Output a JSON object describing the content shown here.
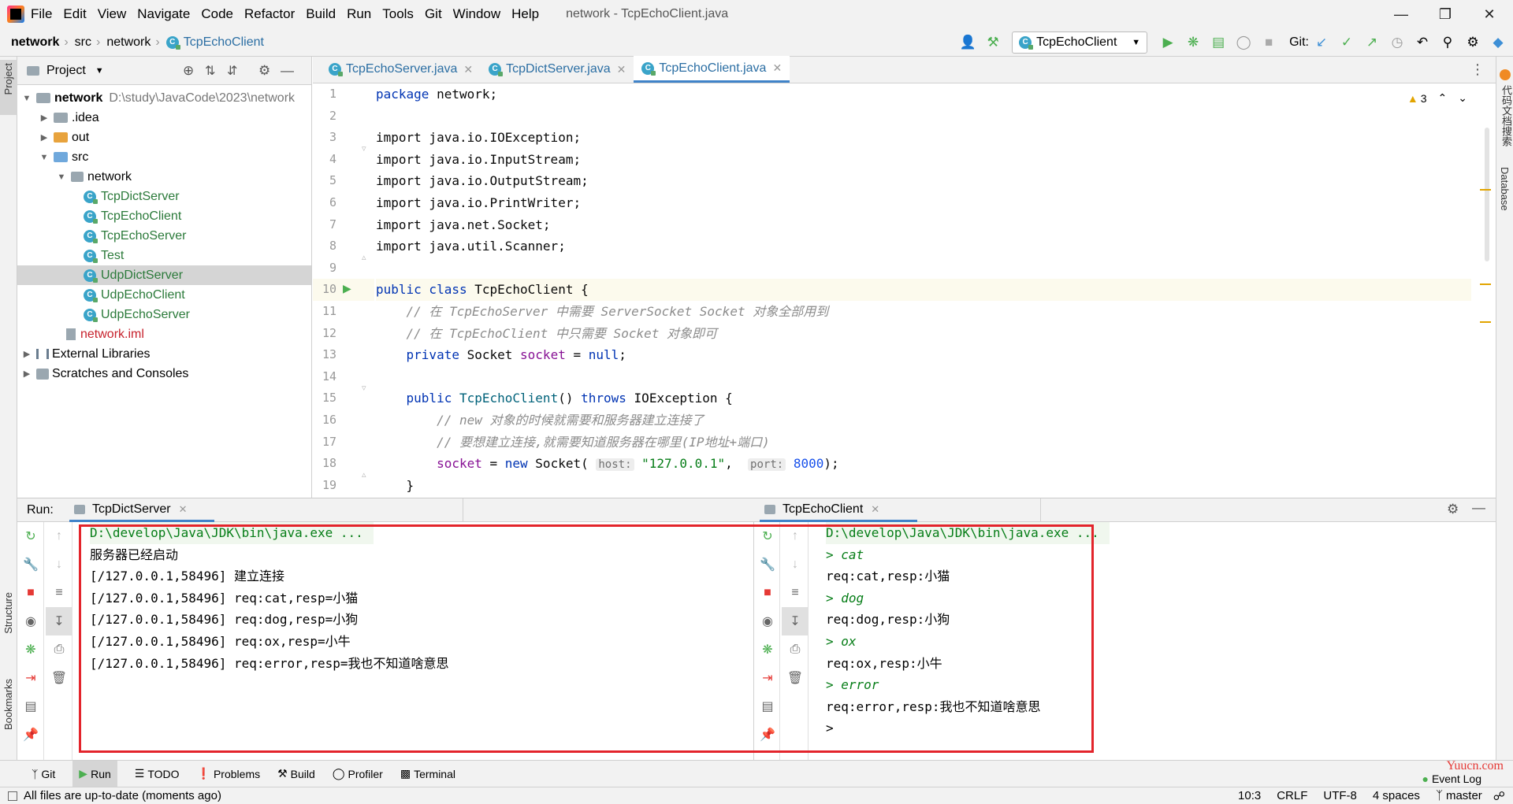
{
  "menubar": {
    "items": [
      "File",
      "Edit",
      "View",
      "Navigate",
      "Code",
      "Refactor",
      "Build",
      "Run",
      "Tools",
      "Git",
      "Window",
      "Help"
    ],
    "title": "network - TcpEchoClient.java"
  },
  "navbar": {
    "breadcrumbs": [
      "network",
      "src",
      "network",
      "TcpEchoClient"
    ],
    "run_config": "TcpEchoClient",
    "git_label": "Git:"
  },
  "project": {
    "title": "Project",
    "root_name": "network",
    "root_path": "D:\\study\\JavaCode\\2023\\network",
    "items": [
      {
        "label": "network",
        "level": 0
      },
      {
        "label": ".idea",
        "level": 1
      },
      {
        "label": "out",
        "level": 1
      },
      {
        "label": "src",
        "level": 1
      },
      {
        "label": "network",
        "level": 2
      },
      {
        "label": "TcpDictServer",
        "level": 3
      },
      {
        "label": "TcpEchoClient",
        "level": 3
      },
      {
        "label": "TcpEchoServer",
        "level": 3
      },
      {
        "label": "Test",
        "level": 3
      },
      {
        "label": "UdpDictServer",
        "level": 3
      },
      {
        "label": "UdpEchoClient",
        "level": 3
      },
      {
        "label": "UdpEchoServer",
        "level": 3
      },
      {
        "label": "network.iml",
        "level": 2
      },
      {
        "label": "External Libraries",
        "level": 0
      },
      {
        "label": "Scratches and Consoles",
        "level": 0
      }
    ]
  },
  "editor": {
    "tabs": [
      "TcpEchoServer.java",
      "TcpDictServer.java",
      "TcpEchoClient.java"
    ],
    "active_tab": 2,
    "warnings": "3",
    "line_numbers": [
      "1",
      "2",
      "3",
      "4",
      "5",
      "6",
      "7",
      "8",
      "9",
      "10",
      "11",
      "12",
      "13",
      "14",
      "15",
      "16",
      "17",
      "18",
      "19"
    ],
    "code": {
      "l1": "package network;",
      "l3": "import java.io.IOException;",
      "l4": "import java.io.InputStream;",
      "l5": "import java.io.OutputStream;",
      "l6": "import java.io.PrintWriter;",
      "l7": "import java.net.Socket;",
      "l8": "import java.util.Scanner;",
      "l10_kw": "public class ",
      "l10_name": "TcpEchoClient {",
      "l11": "// 在 TcpEchoServer 中需要 ServerSocket Socket 对象全部用到",
      "l12": "// 在 TcpEchoClient 中只需要 Socket 对象即可",
      "l13_kw": "private ",
      "l13_type": "Socket ",
      "l13_field": "socket",
      "l13_rest": " = ",
      "l13_null": "null",
      "l13_end": ";",
      "l15_kw": "public ",
      "l15_name": "TcpEchoClient",
      "l15_paren": "() ",
      "l15_throws": "throws ",
      "l15_rest": "IOException {",
      "l16": "// new 对象的时候就需要和服务器建立连接了",
      "l17": "// 要想建立连接,就需要知道服务器在哪里(IP地址+端口)",
      "l18_field": "socket",
      "l18_eq": " = ",
      "l18_new": "new ",
      "l18_cls": "Socket( ",
      "l18_hint1": "host:",
      "l18_str": "\"127.0.0.1\"",
      "l18_comma": ",  ",
      "l18_hint2": "port:",
      "l18_num": "8000",
      "l18_end": ");",
      "l19": "}"
    }
  },
  "run": {
    "label": "Run:",
    "tab_left": "TcpDictServer",
    "tab_right": "TcpEchoClient",
    "left_console": [
      "D:\\develop\\Java\\JDK\\bin\\java.exe ...",
      "服务器已经启动",
      "[/127.0.0.1,58496] 建立连接",
      "[/127.0.0.1,58496] req:cat,resp=小猫",
      "[/127.0.0.1,58496] req:dog,resp=小狗",
      "[/127.0.0.1,58496] req:ox,resp=小牛",
      "[/127.0.0.1,58496] req:error,resp=我也不知道啥意思"
    ],
    "right_console": [
      "D:\\develop\\Java\\JDK\\bin\\java.exe ...",
      "> cat",
      "req:cat,resp:小猫",
      "> dog",
      "req:dog,resp:小狗",
      "> ox",
      "req:ox,resp:小牛",
      "> error",
      "req:error,resp:我也不知道啥意思",
      ">"
    ]
  },
  "side": {
    "left_project": "Project",
    "left_structure": "Structure",
    "left_bookmarks": "Bookmarks",
    "right_top": "代码文档搜索",
    "right_db": "Database"
  },
  "bottom_tabs": [
    "Git",
    "Run",
    "TODO",
    "Problems",
    "Build",
    "Profiler",
    "Terminal"
  ],
  "event_log": "Event Log",
  "status": {
    "message": "All files are up-to-date (moments ago)",
    "position": "10:3",
    "line_sep": "CRLF",
    "encoding": "UTF-8",
    "indent": "4 spaces",
    "branch": "master"
  },
  "watermark": "Yuucn.com",
  "colors": {
    "accent": "#4083c9",
    "highlight_box": "#e3242b",
    "run_green": "#4caf50"
  }
}
